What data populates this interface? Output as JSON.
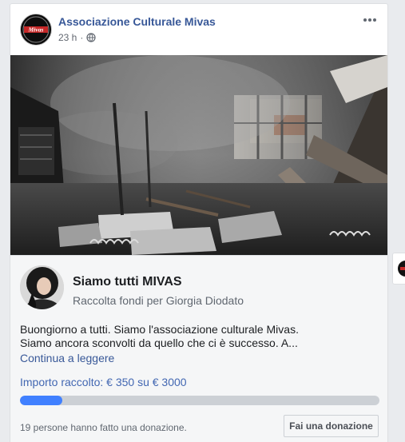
{
  "post": {
    "page_name": "Associazione Culturale Mivas",
    "time": "23 h",
    "separator": "·",
    "audience_icon": "globe-icon",
    "more_icon": "more-horizontal-icon",
    "logo_text": "Mivas"
  },
  "photo": {
    "subject": "burnt-interior-photo"
  },
  "fundraiser": {
    "title": "Siamo tutti MIVAS",
    "subtitle": "Raccolta fondi per Giorgia Diodato",
    "description_lines": [
      "Buongiorno a tutti. Siamo l'associazione culturale Mivas.",
      "Siamo ancora sconvolti da quello che ci è successo. A..."
    ],
    "continue_label": "Continua a leggere",
    "raised_text": "Importo raccolto: € 350 su € 3000",
    "raised_amount": 350,
    "goal_amount": 3000,
    "donors_text": "19 persone hanno fatto una donazione.",
    "donate_label": "Fai una donazione"
  },
  "colors": {
    "link": "#385898",
    "progress": "#4080ff",
    "raised_text": "#4267b2",
    "track": "#ccd0d5"
  }
}
